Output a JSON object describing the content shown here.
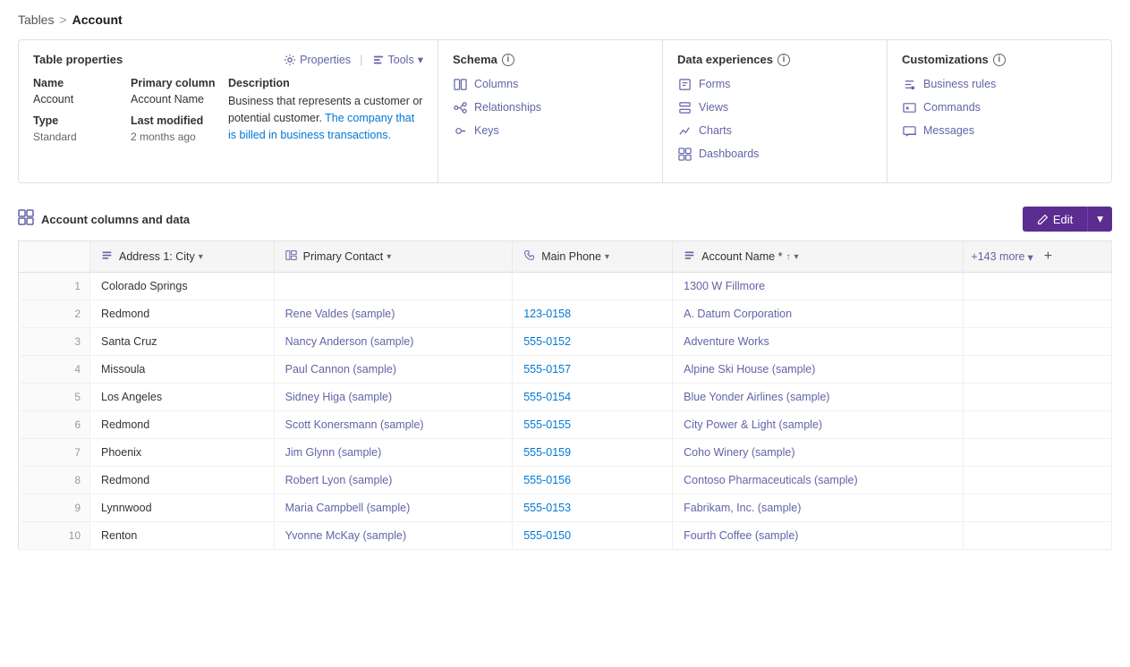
{
  "breadcrumb": {
    "parent": "Tables",
    "separator": ">",
    "current": "Account"
  },
  "tableProps": {
    "title": "Table properties",
    "propertiesLabel": "Properties",
    "toolsLabel": "Tools",
    "columns": [
      {
        "label": "Name",
        "value": "Account",
        "sub": ""
      },
      {
        "label": "Primary column",
        "value": "Account Name",
        "sub": ""
      },
      {
        "label": "Type",
        "value": "",
        "sub": "Standard"
      },
      {
        "label": "Last modified",
        "value": "",
        "sub": "2 months ago"
      }
    ],
    "descriptionLabel": "Description",
    "description": "Business that represents a customer or potential customer.",
    "descriptionLink": "The company that is billed in business transactions."
  },
  "schema": {
    "title": "Schema",
    "links": [
      {
        "label": "Columns",
        "icon": "grid"
      },
      {
        "label": "Relationships",
        "icon": "branch"
      },
      {
        "label": "Keys",
        "icon": "key"
      }
    ]
  },
  "dataExperiences": {
    "title": "Data experiences",
    "links": [
      {
        "label": "Forms",
        "icon": "form"
      },
      {
        "label": "Views",
        "icon": "view"
      },
      {
        "label": "Charts",
        "icon": "chart"
      },
      {
        "label": "Dashboards",
        "icon": "dashboard"
      }
    ]
  },
  "customizations": {
    "title": "Customizations",
    "links": [
      {
        "label": "Business rules",
        "icon": "rules"
      },
      {
        "label": "Commands",
        "icon": "commands"
      },
      {
        "label": "Messages",
        "icon": "messages"
      }
    ]
  },
  "dataTable": {
    "sectionTitle": "Account columns and data",
    "editLabel": "Edit",
    "columns": [
      {
        "label": "Address 1: City",
        "icon": "text"
      },
      {
        "label": "Primary Contact",
        "icon": "lookup"
      },
      {
        "label": "Main Phone",
        "icon": "phone"
      },
      {
        "label": "Account Name",
        "icon": "text",
        "required": true,
        "sort": "asc"
      },
      {
        "label": "+143 more",
        "extra": true
      }
    ],
    "rows": [
      {
        "city": "Colorado Springs",
        "contact": "",
        "phone": "",
        "account": "1300 W Fillmore"
      },
      {
        "city": "Redmond",
        "contact": "Rene Valdes (sample)",
        "phone": "123-0158",
        "account": "A. Datum Corporation"
      },
      {
        "city": "Santa Cruz",
        "contact": "Nancy Anderson (sample)",
        "phone": "555-0152",
        "account": "Adventure Works"
      },
      {
        "city": "Missoula",
        "contact": "Paul Cannon (sample)",
        "phone": "555-0157",
        "account": "Alpine Ski House (sample)"
      },
      {
        "city": "Los Angeles",
        "contact": "Sidney Higa (sample)",
        "phone": "555-0154",
        "account": "Blue Yonder Airlines (sample)"
      },
      {
        "city": "Redmond",
        "contact": "Scott Konersmann (sample)",
        "phone": "555-0155",
        "account": "City Power & Light (sample)"
      },
      {
        "city": "Phoenix",
        "contact": "Jim Glynn (sample)",
        "phone": "555-0159",
        "account": "Coho Winery (sample)"
      },
      {
        "city": "Redmond",
        "contact": "Robert Lyon (sample)",
        "phone": "555-0156",
        "account": "Contoso Pharmaceuticals (sample)"
      },
      {
        "city": "Lynnwood",
        "contact": "Maria Campbell (sample)",
        "phone": "555-0153",
        "account": "Fabrikam, Inc. (sample)"
      },
      {
        "city": "Renton",
        "contact": "Yvonne McKay (sample)",
        "phone": "555-0150",
        "account": "Fourth Coffee (sample)"
      }
    ]
  }
}
